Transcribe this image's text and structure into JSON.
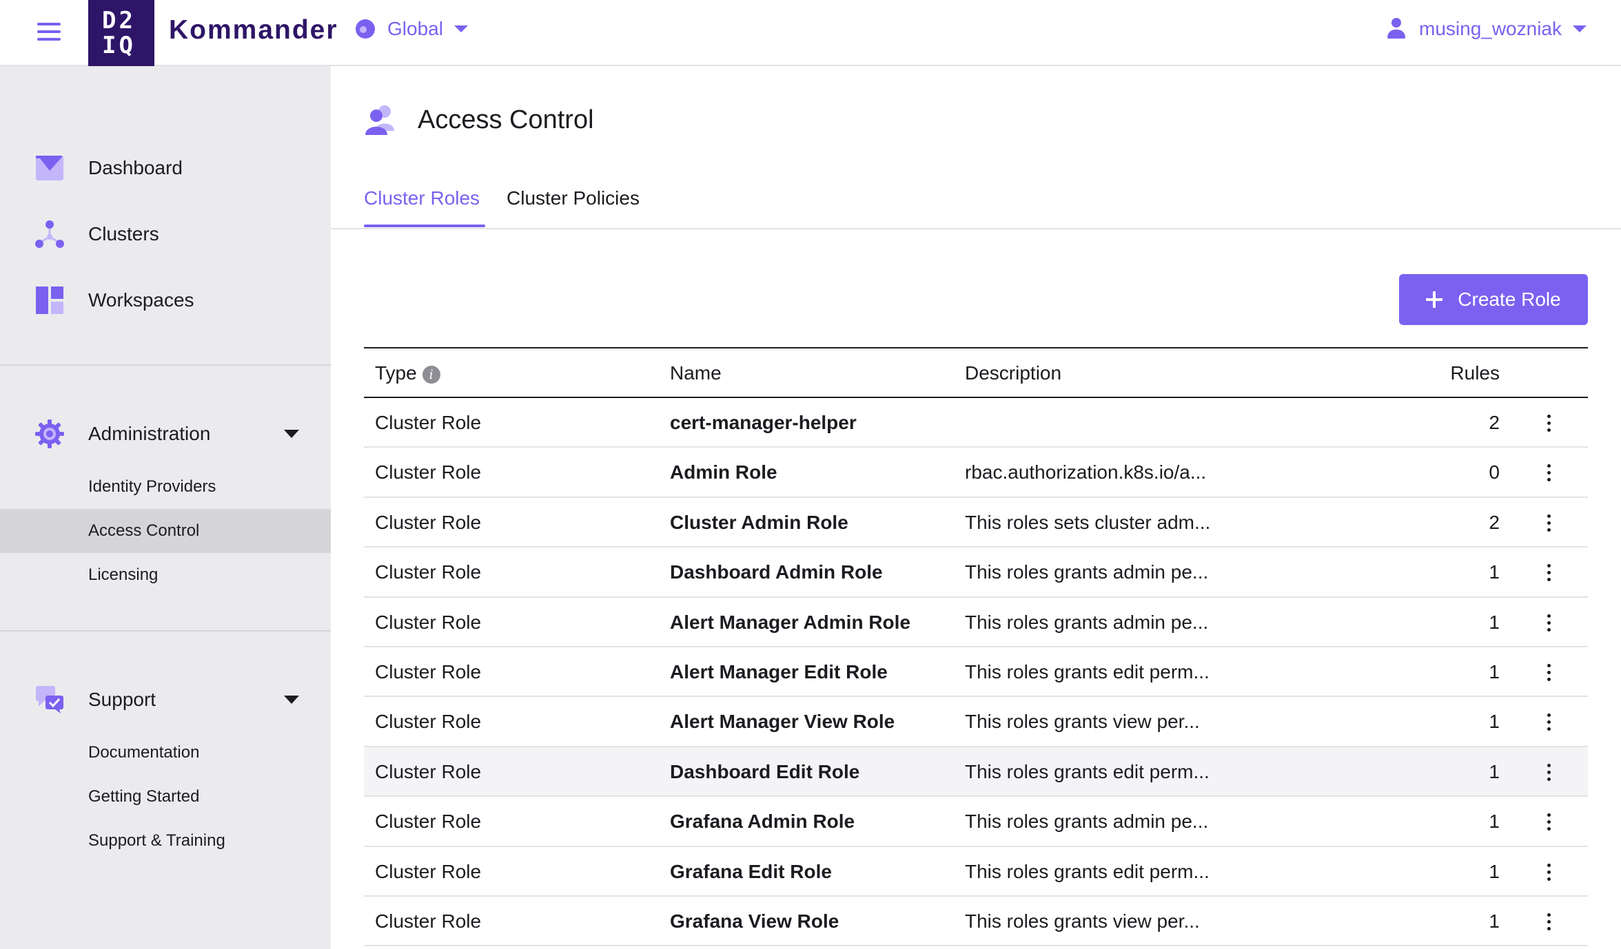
{
  "header": {
    "brand_logo_line1": "D2",
    "brand_logo_line2": "IQ",
    "app_name": "Kommander",
    "scope_label": "Global",
    "username": "musing_wozniak"
  },
  "sidebar": {
    "items": [
      {
        "label": "Dashboard"
      },
      {
        "label": "Clusters"
      },
      {
        "label": "Workspaces"
      }
    ],
    "administration": {
      "label": "Administration",
      "children": [
        "Identity Providers",
        "Access Control",
        "Licensing"
      ]
    },
    "support": {
      "label": "Support",
      "children": [
        "Documentation",
        "Getting Started",
        "Support & Training"
      ]
    }
  },
  "page": {
    "title": "Access Control",
    "tabs": [
      "Cluster Roles",
      "Cluster Policies"
    ],
    "create_button": "Create Role"
  },
  "table": {
    "headers": {
      "type": "Type",
      "name": "Name",
      "description": "Description",
      "rules": "Rules"
    },
    "rows": [
      {
        "type": "Cluster Role",
        "name": "cert-manager-helper",
        "description": "",
        "rules": "2"
      },
      {
        "type": "Cluster Role",
        "name": "Admin Role",
        "description": "rbac.authorization.k8s.io/a...",
        "rules": "0"
      },
      {
        "type": "Cluster Role",
        "name": "Cluster Admin Role",
        "description": "This roles sets cluster adm...",
        "rules": "2"
      },
      {
        "type": "Cluster Role",
        "name": "Dashboard Admin Role",
        "description": "This roles grants admin pe...",
        "rules": "1"
      },
      {
        "type": "Cluster Role",
        "name": "Alert Manager Admin Role",
        "description": "This roles grants admin pe...",
        "rules": "1"
      },
      {
        "type": "Cluster Role",
        "name": "Alert Manager Edit Role",
        "description": "This roles grants edit perm...",
        "rules": "1"
      },
      {
        "type": "Cluster Role",
        "name": "Alert Manager View Role",
        "description": "This roles grants view per...",
        "rules": "1"
      },
      {
        "type": "Cluster Role",
        "name": "Dashboard Edit Role",
        "description": "This roles grants edit perm...",
        "rules": "1"
      },
      {
        "type": "Cluster Role",
        "name": "Grafana Admin Role",
        "description": "This roles grants admin pe...",
        "rules": "1"
      },
      {
        "type": "Cluster Role",
        "name": "Grafana Edit Role",
        "description": "This roles grants edit perm...",
        "rules": "1"
      },
      {
        "type": "Cluster Role",
        "name": "Grafana View Role",
        "description": "This roles grants view per...",
        "rules": "1"
      }
    ]
  },
  "colors": {
    "accent": "#7b61f0",
    "brand_dark": "#2e1567",
    "sidebar_bg": "#ebebee"
  }
}
